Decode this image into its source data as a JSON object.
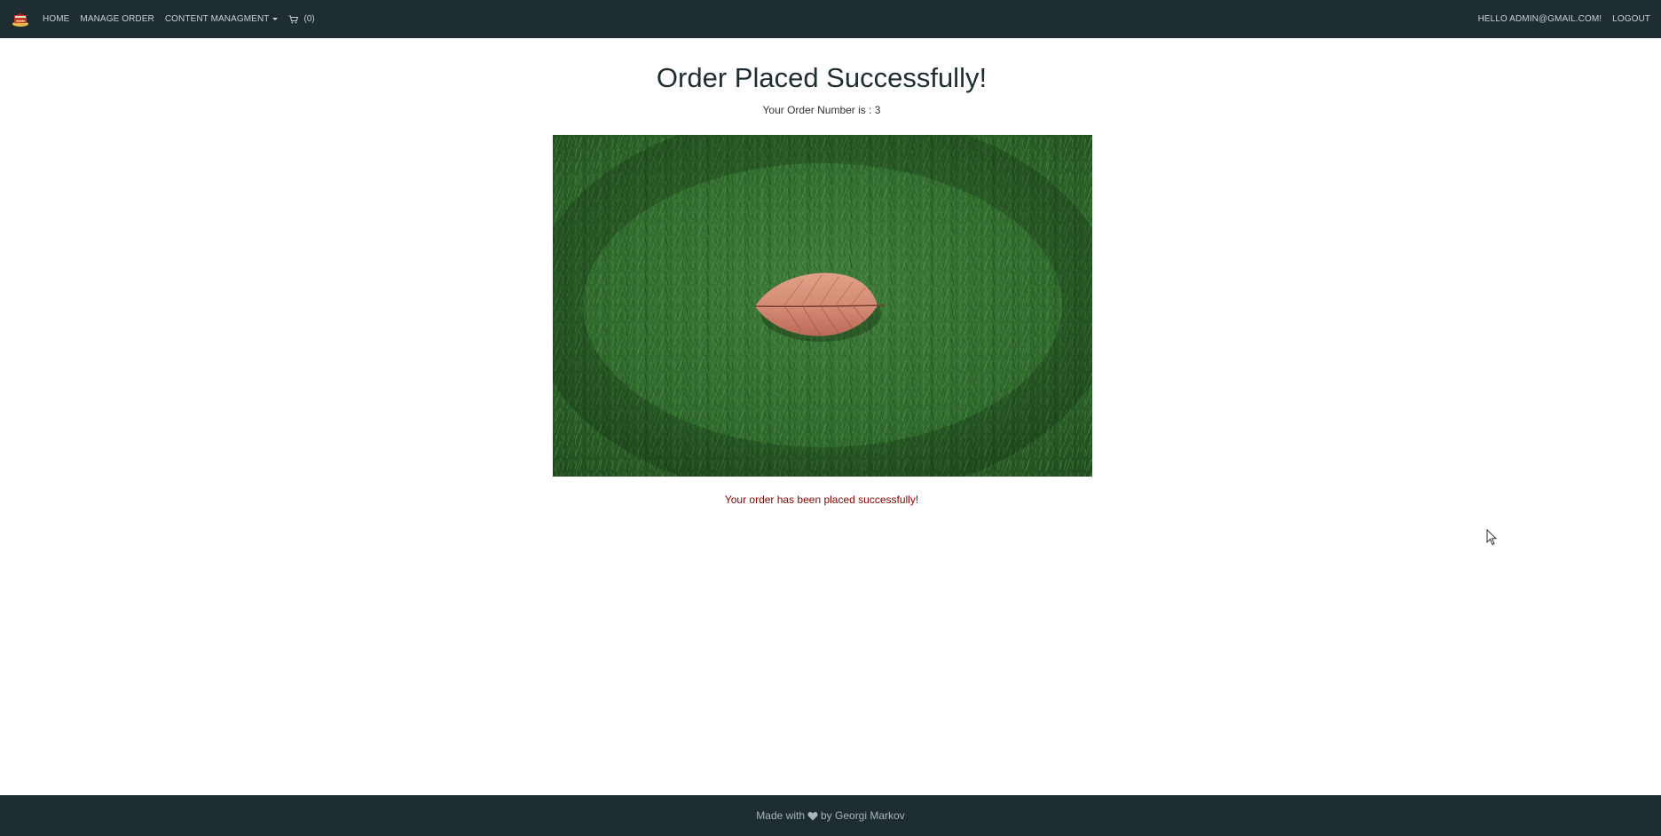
{
  "navbar": {
    "logo_icon": "book-logo-icon",
    "links": {
      "home": "HOME",
      "manage_order": "MANAGE ORDER",
      "content_management": "CONTENT MANAGMENT"
    },
    "cart_count": "(0)",
    "greeting": "HELLO ADMIN@GMAIL.COM!",
    "logout": "LOGOUT"
  },
  "main": {
    "title": "Order Placed Successfully!",
    "order_number": "Your Order Number is : 3",
    "image_icon": "leaf-on-grass-image",
    "success_message": "Your order has been placed successfully!"
  },
  "footer": {
    "made_with": "Made with",
    "by": "by Georgi Markov"
  },
  "colors": {
    "navbar_bg": "#1d2d32",
    "success_text": "#8b0000"
  }
}
